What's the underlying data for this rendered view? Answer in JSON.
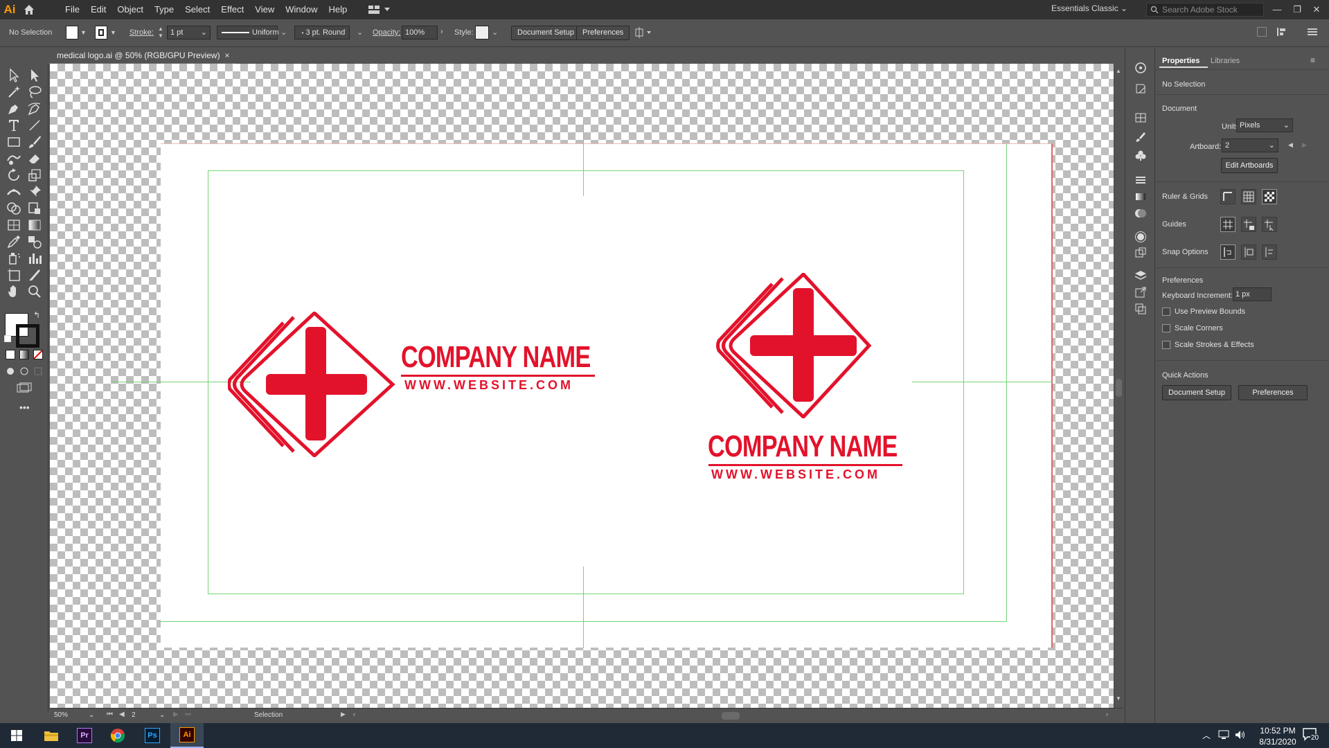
{
  "app": {
    "logo_text": "Ai",
    "accent": "#ff9a00"
  },
  "menu": [
    "File",
    "Edit",
    "Object",
    "Type",
    "Select",
    "Effect",
    "View",
    "Window",
    "Help"
  ],
  "workspace": "Essentials Classic",
  "search_placeholder": "Search Adobe Stock",
  "controlbar": {
    "selection": "No Selection",
    "stroke_label": "Stroke:",
    "stroke_weight": "1 pt",
    "profile": "Uniform",
    "brush": "3 pt. Round",
    "opacity_label": "Opacity:",
    "opacity_value": "100%",
    "style_label": "Style:",
    "document_setup": "Document Setup",
    "preferences": "Preferences"
  },
  "document_tab": {
    "title": "medical logo.ai @ 50% (RGB/GPU Preview)",
    "close": "×"
  },
  "artwork": {
    "brand_color": "#e3122b",
    "company_name": "COMPANY NAME",
    "website": "WWW.WEBSITE.COM"
  },
  "status": {
    "zoom": "50%",
    "artboard": "2",
    "tool": "Selection"
  },
  "properties": {
    "tab_properties": "Properties",
    "tab_libraries": "Libraries",
    "no_selection": "No Selection",
    "document_header": "Document",
    "units_label": "Units:",
    "units_value": "Pixels",
    "artboard_label": "Artboard:",
    "artboard_value": "2",
    "edit_artboards": "Edit Artboards",
    "ruler_grids": "Ruler & Grids",
    "guides": "Guides",
    "snap_options": "Snap Options",
    "preferences_header": "Preferences",
    "keyboard_increment_label": "Keyboard Increment:",
    "keyboard_increment_value": "1 px",
    "use_preview_bounds": "Use Preview Bounds",
    "scale_corners": "Scale Corners",
    "scale_strokes": "Scale Strokes & Effects",
    "quick_actions": "Quick Actions",
    "qa_document_setup": "Document Setup",
    "qa_preferences": "Preferences"
  },
  "taskbar": {
    "apps": [
      "windows-start",
      "file-explorer",
      "premiere-pro",
      "chrome",
      "photoshop",
      "illustrator"
    ],
    "premiere_text": "Pr",
    "photoshop_text": "Ps",
    "illustrator_text": "Ai",
    "time": "10:52 PM",
    "date": "8/31/2020",
    "notifications": "20"
  }
}
